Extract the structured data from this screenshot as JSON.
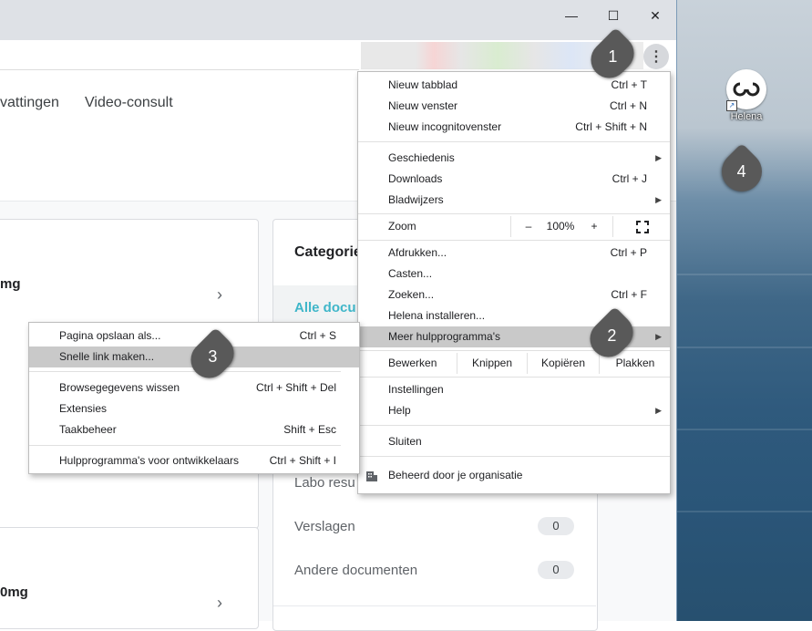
{
  "desktop": {
    "shortcut_label": "Helena"
  },
  "window": {
    "minimize_icon": "minimize-icon",
    "maximize_icon": "maximize-icon",
    "close_icon": "close-icon"
  },
  "page": {
    "nav_tabs": [
      "vattingen",
      "Video-consult"
    ],
    "card_texts": [
      "mg",
      "0mg"
    ],
    "categories_title": "Categorie",
    "categories": [
      {
        "label": "Alle docu",
        "active": true
      },
      {
        "label": "Labo resu"
      },
      {
        "label": "Verslagen",
        "count": "0"
      },
      {
        "label": "Andere documenten",
        "count": "0"
      }
    ]
  },
  "chrome_menu": {
    "new_tab": {
      "label": "Nieuw tabblad",
      "shortcut": "Ctrl + T"
    },
    "new_window": {
      "label": "Nieuw venster",
      "shortcut": "Ctrl + N"
    },
    "new_incognito": {
      "label": "Nieuw incognitovenster",
      "shortcut": "Ctrl + Shift + N"
    },
    "history": {
      "label": "Geschiedenis"
    },
    "downloads": {
      "label": "Downloads",
      "shortcut": "Ctrl + J"
    },
    "bookmarks": {
      "label": "Bladwijzers"
    },
    "zoom": {
      "label": "Zoom",
      "minus": "–",
      "value": "100%",
      "plus": "+"
    },
    "print": {
      "label": "Afdrukken...",
      "shortcut": "Ctrl + P"
    },
    "cast": {
      "label": "Casten..."
    },
    "find": {
      "label": "Zoeken...",
      "shortcut": "Ctrl + F"
    },
    "install": {
      "label": "Helena installeren..."
    },
    "more_tools": {
      "label": "Meer hulpprogramma's"
    },
    "edit": {
      "label": "Bewerken",
      "cut": "Knippen",
      "copy": "Kopiëren",
      "paste": "Plakken"
    },
    "settings": {
      "label": "Instellingen"
    },
    "help": {
      "label": "Help"
    },
    "exit": {
      "label": "Sluiten"
    },
    "managed": {
      "label": "Beheerd door je organisatie"
    }
  },
  "submenu": {
    "save_page": {
      "label": "Pagina opslaan als...",
      "shortcut": "Ctrl + S"
    },
    "create_shortcut": {
      "label": "Snelle link maken..."
    },
    "clear_data": {
      "label": "Browsegegevens wissen",
      "shortcut": "Ctrl + Shift + Del"
    },
    "extensions": {
      "label": "Extensies"
    },
    "task_manager": {
      "label": "Taakbeheer",
      "shortcut": "Shift + Esc"
    },
    "dev_tools": {
      "label": "Hulpprogramma's voor ontwikkelaars",
      "shortcut": "Ctrl + Shift + I"
    }
  },
  "callouts": [
    "1",
    "2",
    "3",
    "4"
  ]
}
